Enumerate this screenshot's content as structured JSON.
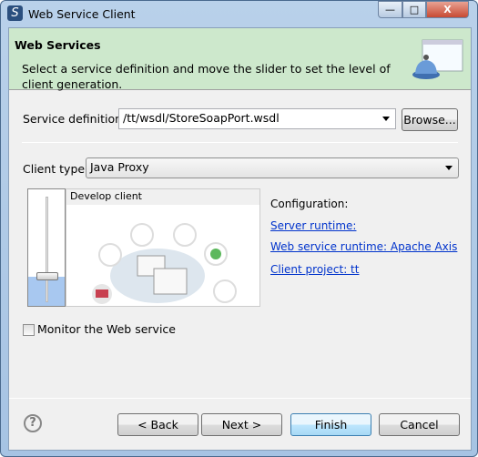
{
  "window": {
    "title": "Web Service Client",
    "minimize": "—",
    "maximize": "□",
    "close": "X"
  },
  "banner": {
    "title": "Web Services",
    "description": "Select a service definition and move the slider to set the level of client generation.",
    "icon": "web-service-bell-icon"
  },
  "service_definition": {
    "label": "Service definition:",
    "value": "/tt/wsdl/StoreSoapPort.wsdl",
    "browse_label": "Browse..."
  },
  "client_type": {
    "label": "Client type:",
    "value": "Java Proxy"
  },
  "slider": {
    "header": "Develop client",
    "level": "Develop client",
    "level_index": 1,
    "levels_count": 6
  },
  "configuration": {
    "label": "Configuration:",
    "server_runtime": "Server runtime: ",
    "ws_runtime": "Web service runtime: Apache Axis",
    "client_project": "Client project: tt"
  },
  "monitor": {
    "label": "Monitor the Web service",
    "checked": false
  },
  "buttons": {
    "back": "< Back",
    "next": "Next >",
    "finish": "Finish",
    "cancel": "Cancel",
    "help": "?"
  }
}
